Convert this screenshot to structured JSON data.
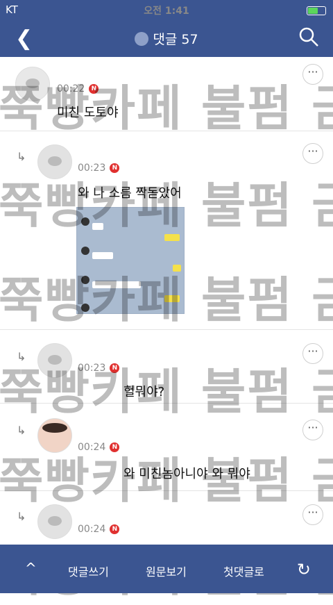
{
  "statusbar": {
    "carrier": "KT",
    "time": "오전 1:41",
    "battery_level": 0.6
  },
  "header": {
    "title": "댓글 57",
    "back_icon": "chevron-left-icon",
    "search_icon": "search-icon"
  },
  "watermark": {
    "text": "쭉빵카페 불펌 금지"
  },
  "comments": [
    {
      "time": "00:22",
      "badge": "N",
      "text": "미친 도토야"
    },
    {
      "time": "00:23",
      "badge": "N",
      "text": "와 나 소름 짝돋았어"
    },
    {
      "time": "00:23",
      "badge": "N",
      "text": "헐뭐야?"
    },
    {
      "time": "00:24",
      "badge": "N",
      "text": "와 미친놈아니야 와 뭐야"
    },
    {
      "time": "00:24",
      "badge": "N",
      "text": ""
    }
  ],
  "more_label": "···",
  "reply_arrow": "↳",
  "bottombar": {
    "up_label": "^",
    "write": "댓글쓰기",
    "original": "원문보기",
    "first": "첫댓글로",
    "refresh_icon": "refresh-icon"
  }
}
